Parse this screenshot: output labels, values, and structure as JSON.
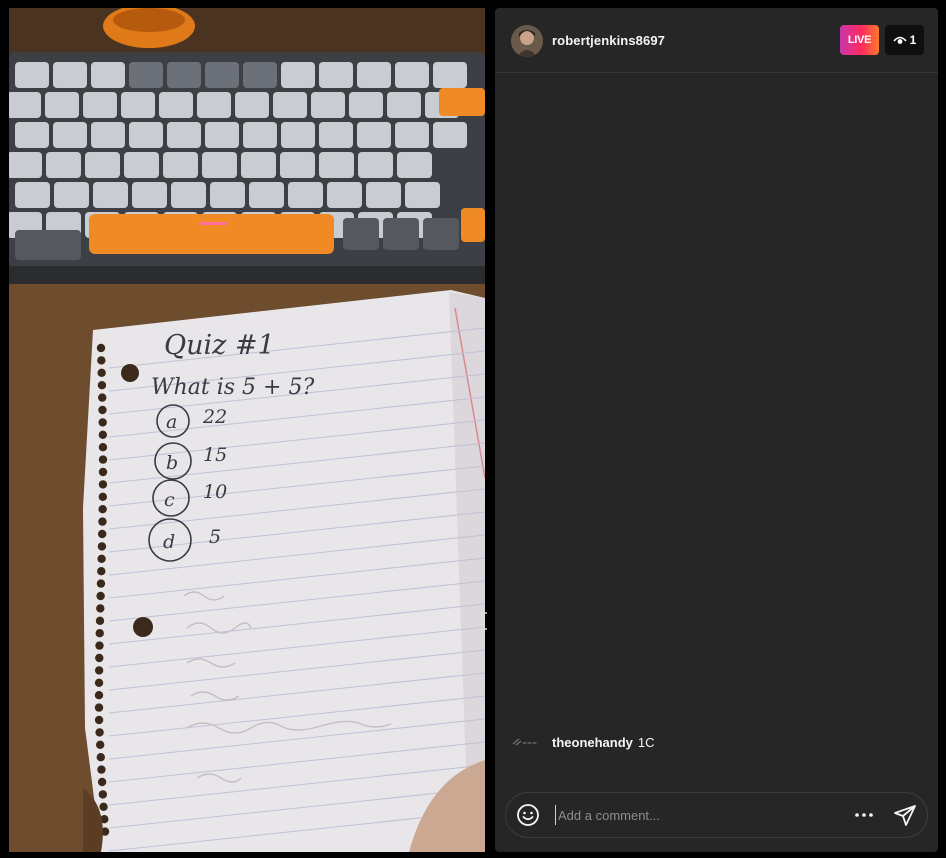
{
  "stream": {
    "username": "robertjenkins8697",
    "live_label": "LIVE",
    "viewer_count": "1"
  },
  "video": {
    "description_icon": "live-video-feed",
    "notebook": {
      "title": "Quiz #1",
      "question": "What is 5 + 5?",
      "options": [
        {
          "letter": "a",
          "value": "22"
        },
        {
          "letter": "b",
          "value": "15"
        },
        {
          "letter": "c",
          "value": "10"
        },
        {
          "letter": "d",
          "value": "5"
        }
      ]
    }
  },
  "comments": [
    {
      "user": "theonehandy",
      "text": "1C"
    }
  ],
  "composer": {
    "placeholder": "Add a comment...",
    "emoji_icon": "smiley-icon",
    "more_icon": "ellipsis-icon",
    "send_icon": "paper-plane-icon"
  },
  "colors": {
    "panel_bg": "#262626",
    "live_gradient_start": "#c837ab",
    "live_gradient_end": "#ff7a2a",
    "keyboard_accent": "#f08a24"
  }
}
